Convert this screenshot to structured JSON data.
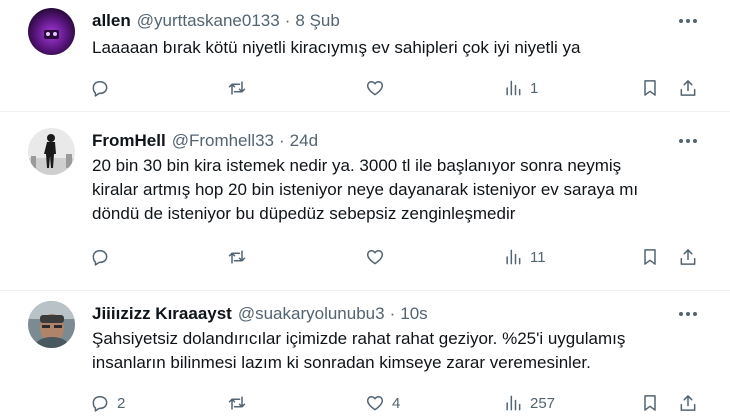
{
  "tweets": [
    {
      "name": "allen",
      "handle": "@yurttaskane0133",
      "dot": "·",
      "time": "8 Şub",
      "text": "Laaaaan bırak kötü niyetli kiracıymış ev sahipleri çok iyi niyetli ya",
      "replies": "",
      "retweets": "",
      "likes": "",
      "views": "1"
    },
    {
      "name": "FromHell",
      "handle": "@Fromhell33",
      "dot": "·",
      "time": "24d",
      "text": "20 bin 30 bin kira istemek nedir ya. 3000 tl ile başlanıyor sonra neymiş kiralar artmış hop 20 bin isteniyor neye dayanarak isteniyor ev saraya mı döndü de isteniyor bu düpedüz sebepsiz zenginleşmedir",
      "replies": "",
      "retweets": "",
      "likes": "",
      "views": "11"
    },
    {
      "name": "Jiiiızizz Kıraaayst",
      "handle": "@suakaryolunubu3",
      "dot": "·",
      "time": "10s",
      "text": "Şahsiyetsiz dolandırıcılar içimizde rahat rahat geziyor. %25'i uygulamış insanların bilinmesi lazım ki sonradan kimseye zarar veremesinler.",
      "replies": "2",
      "retweets": "",
      "likes": "4",
      "views": "257"
    }
  ],
  "icons": {
    "reply": "reply-icon",
    "retweet": "retweet-icon",
    "like": "heart-icon",
    "views": "views-icon",
    "bookmark": "bookmark-icon",
    "share": "share-icon",
    "more": "more-icon"
  },
  "colors": {
    "text": "#0f1419",
    "secondary": "#536471",
    "divider": "#eff3f4"
  }
}
